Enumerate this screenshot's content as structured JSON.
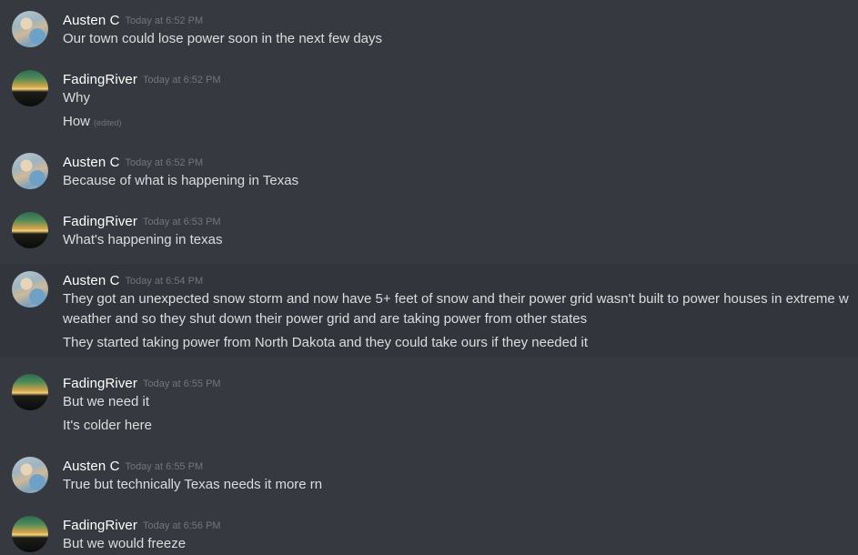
{
  "messages": [
    {
      "author": "Austen C",
      "timestamp": "Today at 6:52 PM",
      "lines": [
        {
          "text": "Our town could lose power soon in the next few days"
        }
      ]
    },
    {
      "author": "FadingRiver",
      "timestamp": "Today at 6:52 PM",
      "lines": [
        {
          "text": "Why"
        },
        {
          "text": "How",
          "edited": "(edited)"
        }
      ]
    },
    {
      "author": "Austen C",
      "timestamp": "Today at 6:52 PM",
      "lines": [
        {
          "text": "Because of what is happening in Texas"
        }
      ]
    },
    {
      "author": "FadingRiver",
      "timestamp": "Today at 6:53 PM",
      "lines": [
        {
          "text": "What's happening in texas"
        }
      ]
    },
    {
      "author": "Austen C",
      "timestamp": "Today at 6:54 PM",
      "lines": [
        {
          "text": "They got an unexpected snow storm and now have 5+ feet of snow and their power grid wasn't built to power houses in extreme w"
        },
        {
          "text": "weather and so they shut down their power grid and are taking power from other states"
        },
        {
          "text": "They started taking power from North Dakota and they could take ours if they needed it"
        }
      ]
    },
    {
      "author": "FadingRiver",
      "timestamp": "Today at 6:55 PM",
      "lines": [
        {
          "text": "But we need it"
        },
        {
          "text": "It's colder here"
        }
      ]
    },
    {
      "author": "Austen C",
      "timestamp": "Today at 6:55 PM",
      "lines": [
        {
          "text": "True but technically Texas needs it more rn"
        }
      ]
    },
    {
      "author": "FadingRiver",
      "timestamp": "Today at 6:56 PM",
      "lines": [
        {
          "text": "But we would freeze"
        }
      ]
    }
  ]
}
